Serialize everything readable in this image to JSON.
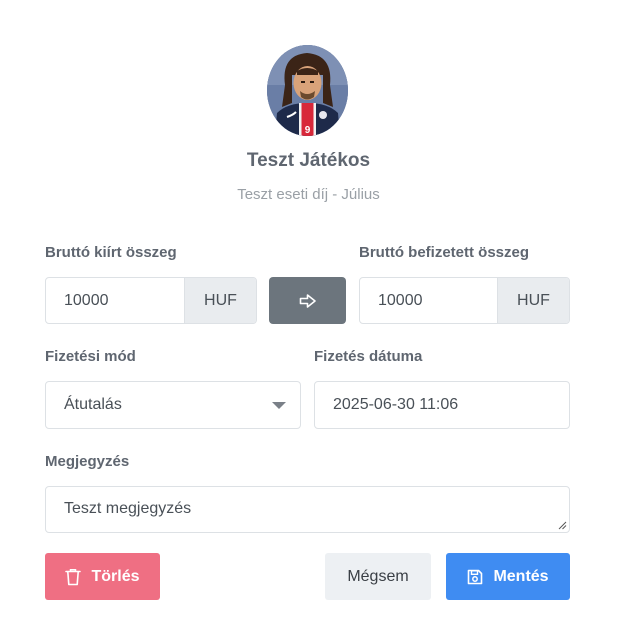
{
  "player": {
    "name": "Teszt Játékos",
    "fee_title": "Teszt eseti díj - Július"
  },
  "form": {
    "gross_due": {
      "label": "Bruttó kiírt összeg",
      "value": "10000",
      "currency": "HUF"
    },
    "gross_paid": {
      "label": "Bruttó befizetett összeg",
      "value": "10000",
      "currency": "HUF"
    },
    "payment_method": {
      "label": "Fizetési mód",
      "value": "Átutalás"
    },
    "payment_date": {
      "label": "Fizetés dátuma",
      "value": "2025-06-30 11:06"
    },
    "note": {
      "label": "Megjegyzés",
      "value": "Teszt megjegyzés"
    }
  },
  "buttons": {
    "delete": "Törlés",
    "cancel": "Mégsem",
    "save": "Mentés"
  },
  "icons": {
    "copy": "arrow-right-icon",
    "delete": "trash-icon",
    "save": "floppy-disk-icon"
  },
  "colors": {
    "delete": "#ef6f83",
    "save": "#3f8cf2",
    "copy": "#6c757d"
  }
}
